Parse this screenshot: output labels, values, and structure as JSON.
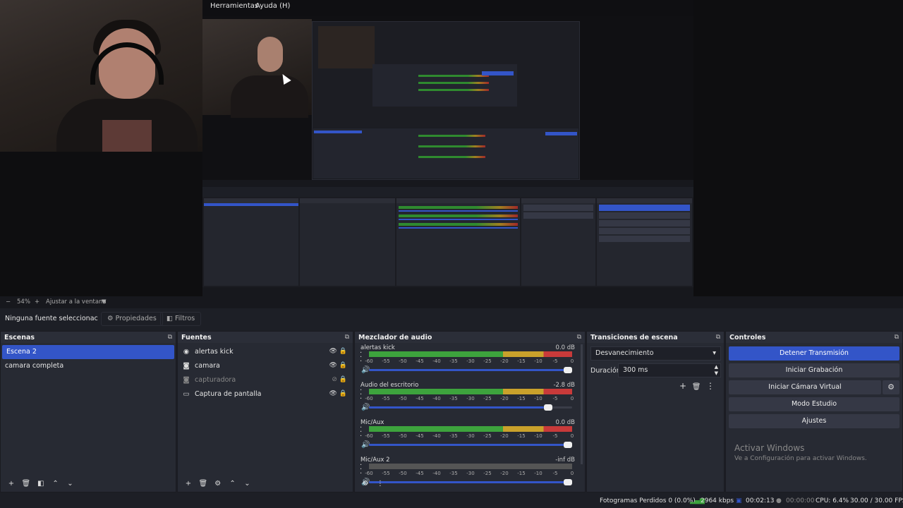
{
  "menu": {
    "tools": "Herramientas",
    "help": "Ayuda (H)"
  },
  "zoom": {
    "minus": "−",
    "level": "54%",
    "plus": "+",
    "fit": "Ajustar a la ventana",
    "dropdown": "▼"
  },
  "properties_bar": {
    "selection": "Ninguna fuente seleccionac",
    "properties": "Propiedades",
    "filters": "Filtros"
  },
  "scenes": {
    "title": "Escenas",
    "items": [
      {
        "label": "Escena 2"
      },
      {
        "label": "camara completa"
      }
    ]
  },
  "sources": {
    "title": "Fuentes",
    "items": [
      {
        "label": "alertas kick"
      },
      {
        "label": "camara"
      },
      {
        "label": "capturadora"
      },
      {
        "label": "Captura de pantalla"
      }
    ]
  },
  "mixer": {
    "title": "Mezclador de audio",
    "channels": [
      {
        "name": "alertas kick",
        "db": "0.0 dB",
        "level": 1.0,
        "volume": 1.0
      },
      {
        "name": "Audio del escritorio",
        "db": "-2.8 dB",
        "level": 1.0,
        "volume": 0.86
      },
      {
        "name": "Mic/Aux",
        "db": "0.0 dB",
        "level": 1.0,
        "volume": 1.0
      },
      {
        "name": "Mic/Aux 2",
        "db": "-inf dB",
        "level": 0.0,
        "volume": 1.0
      }
    ],
    "ticks": [
      "-60",
      "-55",
      "-50",
      "-45",
      "-40",
      "-35",
      "-30",
      "-25",
      "-20",
      "-15",
      "-10",
      "-5",
      "0"
    ]
  },
  "transitions": {
    "title": "Transiciones de escena",
    "selected": "Desvanecimiento",
    "duration_label": "Duración",
    "duration_value": "300 ms"
  },
  "controls": {
    "title": "Controles",
    "stop_stream": "Detener Transmisión",
    "start_recording": "Iniciar Grabación",
    "virtual_cam": "Iniciar Cámara Virtual",
    "studio_mode": "Modo Estudio",
    "settings": "Ajustes"
  },
  "activation": {
    "title": "Activar Windows",
    "subtitle": "Ve a Configuración para activar Windows."
  },
  "status": {
    "dropped": "Fotogramas Perdidos 0 (0.0%)",
    "bitrate": "2964 kbps",
    "stream_time": "00:02:13",
    "rec_time": "00:00:00",
    "cpu": "CPU: 6.4%",
    "fps": "30.00 / 30.00 FPS"
  },
  "colors": {
    "accent": "#3355c8",
    "panel": "#272a33",
    "background": "#1d1f26"
  }
}
